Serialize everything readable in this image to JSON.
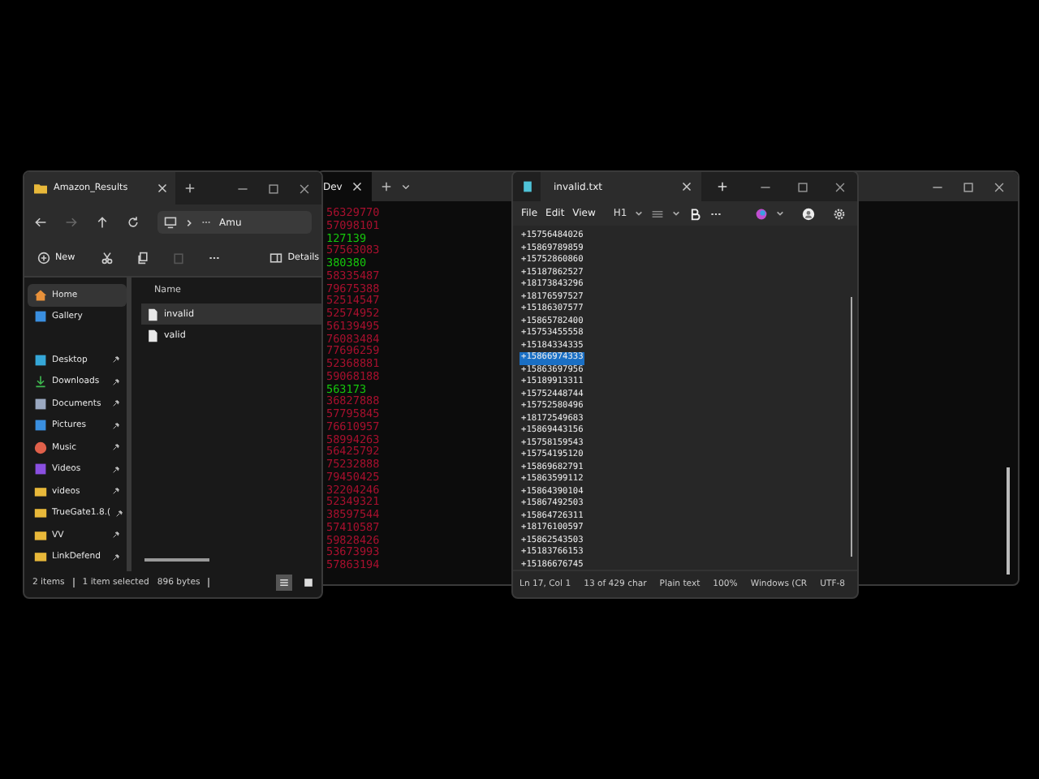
{
  "terminal": {
    "tab_title": "Dev",
    "lines": [
      {
        "text": "56329770",
        "color": "#a8102e"
      },
      {
        "text": "57098101",
        "color": "#a8102e"
      },
      {
        "text": "127139",
        "color": "#16c60c"
      },
      {
        "text": "57563083",
        "color": "#a8102e"
      },
      {
        "text": "380380",
        "color": "#16c60c"
      },
      {
        "text": "58335487",
        "color": "#a8102e"
      },
      {
        "text": "79675388",
        "color": "#a8102e"
      },
      {
        "text": "52514547",
        "color": "#a8102e"
      },
      {
        "text": "52574952",
        "color": "#a8102e"
      },
      {
        "text": "56139495",
        "color": "#a8102e"
      },
      {
        "text": "76083484",
        "color": "#a8102e"
      },
      {
        "text": "77696259",
        "color": "#a8102e"
      },
      {
        "text": "52368881",
        "color": "#a8102e"
      },
      {
        "text": "59068188",
        "color": "#a8102e"
      },
      {
        "text": "563173",
        "color": "#16c60c"
      },
      {
        "text": "36827888",
        "color": "#a8102e"
      },
      {
        "text": "57795845",
        "color": "#a8102e"
      },
      {
        "text": "76610957",
        "color": "#a8102e"
      },
      {
        "text": "58994263",
        "color": "#a8102e"
      },
      {
        "text": "56425792",
        "color": "#a8102e"
      },
      {
        "text": "75232888",
        "color": "#a8102e"
      },
      {
        "text": "79450425",
        "color": "#a8102e"
      },
      {
        "text": "32204246",
        "color": "#a8102e"
      },
      {
        "text": "52349321",
        "color": "#a8102e"
      },
      {
        "text": "38597544",
        "color": "#a8102e"
      },
      {
        "text": "57410587",
        "color": "#a8102e"
      },
      {
        "text": "59828426",
        "color": "#a8102e"
      },
      {
        "text": "53673993",
        "color": "#a8102e"
      },
      {
        "text": "57863194",
        "color": "#a8102e"
      }
    ]
  },
  "explorer": {
    "tab_title": "Amazon_Results",
    "address": "Amu",
    "new_button": "New",
    "details_button": "Details",
    "sidebar": [
      {
        "label": "Home",
        "kind": "home",
        "selected": true,
        "pinned": false
      },
      {
        "label": "Gallery",
        "kind": "gallery",
        "selected": false,
        "pinned": false
      },
      {
        "label": "Desktop",
        "kind": "desktop",
        "selected": false,
        "pinned": true
      },
      {
        "label": "Downloads",
        "kind": "downloads",
        "selected": false,
        "pinned": true
      },
      {
        "label": "Documents",
        "kind": "documents",
        "selected": false,
        "pinned": true
      },
      {
        "label": "Pictures",
        "kind": "pictures",
        "selected": false,
        "pinned": true
      },
      {
        "label": "Music",
        "kind": "music",
        "selected": false,
        "pinned": true
      },
      {
        "label": "Videos",
        "kind": "videos",
        "selected": false,
        "pinned": true
      },
      {
        "label": "videos",
        "kind": "folder",
        "selected": false,
        "pinned": true
      },
      {
        "label": "TrueGate1.8.(",
        "kind": "folder",
        "selected": false,
        "pinned": true
      },
      {
        "label": "VV",
        "kind": "folder",
        "selected": false,
        "pinned": true
      },
      {
        "label": "LinkDefend",
        "kind": "folder",
        "selected": false,
        "pinned": true
      }
    ],
    "column": "Name",
    "files": [
      {
        "name": "invalid",
        "selected": true
      },
      {
        "name": "valid",
        "selected": false
      }
    ],
    "status": [
      "2 items",
      "1 item selected",
      "896 bytes"
    ]
  },
  "notepad": {
    "tab_title": "invalid.txt",
    "menu": [
      "File",
      "Edit",
      "View"
    ],
    "heading_button": "H1",
    "lines": [
      {
        "text": "+15756484026",
        "selected": false
      },
      {
        "text": "+15869789859",
        "selected": false
      },
      {
        "text": "+15752860860",
        "selected": false
      },
      {
        "text": "+15187862527",
        "selected": false
      },
      {
        "text": "+18173843296",
        "selected": false
      },
      {
        "text": "+18176597527",
        "selected": false
      },
      {
        "text": "+15186307577",
        "selected": false
      },
      {
        "text": "+15865782400",
        "selected": false
      },
      {
        "text": "+15753455558",
        "selected": false
      },
      {
        "text": "+15184334335",
        "selected": false
      },
      {
        "text": "+15866974333",
        "selected": true
      },
      {
        "text": "+15863697956",
        "selected": false
      },
      {
        "text": "+15189913311",
        "selected": false
      },
      {
        "text": "+15752448744",
        "selected": false
      },
      {
        "text": "+15752580496",
        "selected": false
      },
      {
        "text": "+18172549683",
        "selected": false
      },
      {
        "text": "+15869443156",
        "selected": false
      },
      {
        "text": "+15758159543",
        "selected": false
      },
      {
        "text": "+15754195120",
        "selected": false
      },
      {
        "text": "+15869682791",
        "selected": false
      },
      {
        "text": "+15863599112",
        "selected": false
      },
      {
        "text": "+15864390104",
        "selected": false
      },
      {
        "text": "+15867492503",
        "selected": false
      },
      {
        "text": "+15864726311",
        "selected": false
      },
      {
        "text": "+18176100597",
        "selected": false
      },
      {
        "text": "+15862543503",
        "selected": false
      },
      {
        "text": "+15183766153",
        "selected": false
      },
      {
        "text": "+15186676745",
        "selected": false
      }
    ],
    "status": [
      "Ln 17, Col 1",
      "13 of 429 char",
      "Plain text",
      "100%",
      "Windows (CR",
      "UTF-8"
    ]
  }
}
